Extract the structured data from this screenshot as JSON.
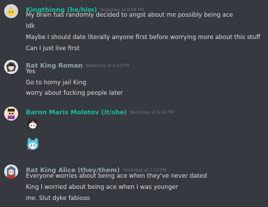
{
  "colors": {
    "background": "#36393f",
    "text": "#dcddde",
    "timestamp": "#72767d",
    "teal": "#1abc9c",
    "gray_name": "#95a5a6"
  },
  "messages": [
    {
      "username": "Kingthinng (he/him)",
      "name_color": "#1abc9c",
      "timestamp": "Yesterday at 6:08 PM",
      "avatar": "lemon-avatar",
      "lines": [
        "My brain has randomly decided to angst about me possibly being ace",
        "Idk",
        "Maybe I should date literally anyone first before worrying more about this stuff",
        "Can I just live first"
      ]
    },
    {
      "username": "Rat King Roman",
      "name_color": "#95a5a6",
      "timestamp": "Yesterday at 6:13 PM",
      "avatar": "anime-character-avatar",
      "lines": [
        "Yes",
        "Go to horny jail King",
        "worry about fucking people later"
      ]
    },
    {
      "username": "Baron Maris Molotov (it/she)",
      "name_color": "#1abc9c",
      "timestamp": "Yesterday at 6:16 PM",
      "avatar": "pixel-character-avatar",
      "emojis": [
        "kuromi-emoji",
        "blue-bunny-emoji"
      ]
    },
    {
      "username": "Rat King Alice (they/them)",
      "name_color": "#95a5a6",
      "timestamp": "Yesterday at 7:12 PM",
      "avatar": "anime-girl-avatar",
      "lines": [
        "Everyone worries about being ace when they've never dated",
        "King I worried about being ace when I was younger"
      ],
      "last_line_italic": "me.",
      "last_line_rest": " Slut dyke fabioso"
    }
  ]
}
